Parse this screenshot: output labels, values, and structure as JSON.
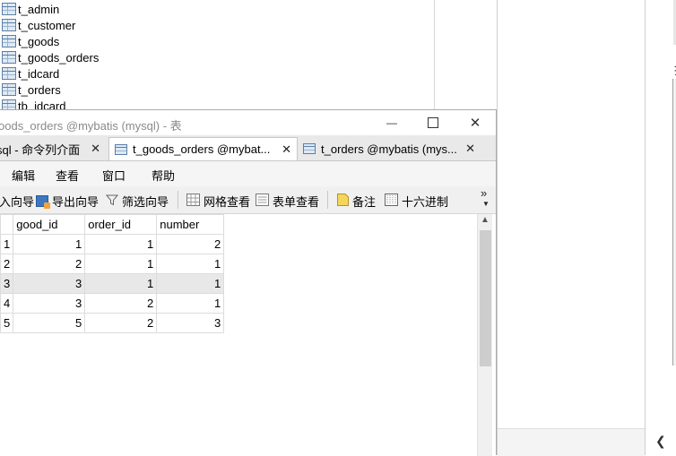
{
  "tree": {
    "items": [
      "t_admin",
      "t_customer",
      "t_goods",
      "t_goods_orders",
      "t_idcard",
      "t_orders",
      "tb_idcard"
    ]
  },
  "window": {
    "title": "oods_orders @mybatis (mysql) - 表",
    "minimize_glyph": "—",
    "maximize_glyph": "☐",
    "close_glyph": "✕"
  },
  "tabs": [
    {
      "label": "sql - 命令列介面",
      "close": "✕",
      "active": false
    },
    {
      "label": "t_goods_orders @mybat...",
      "close": "✕",
      "active": true
    },
    {
      "label": "t_orders @mybatis (mys...",
      "close": "✕",
      "active": false
    }
  ],
  "menu": [
    "编辑",
    "查看",
    "窗口",
    "帮助"
  ],
  "toolbar": {
    "import": "入向导",
    "export": "导出向导",
    "filter": "筛选向导",
    "grid_view": "网格查看",
    "form_view": "表单查看",
    "memo": "备注",
    "hex": "十六进制",
    "more": "»"
  },
  "grid": {
    "columns": [
      "good_id",
      "order_id",
      "number"
    ],
    "rows": [
      {
        "idx": "1",
        "good_id": "1",
        "order_id": "1",
        "number": "2"
      },
      {
        "idx": "2",
        "good_id": "2",
        "order_id": "1",
        "number": "1"
      },
      {
        "idx": "3",
        "good_id": "3",
        "order_id": "1",
        "number": "1"
      },
      {
        "idx": "4",
        "good_id": "3",
        "order_id": "2",
        "number": "1"
      },
      {
        "idx": "5",
        "good_id": "5",
        "order_id": "2",
        "number": "3"
      }
    ],
    "selected_row": "3"
  },
  "right_pane": {
    "mark": "找",
    "scroll_left": "❮"
  },
  "colors": {
    "selected_row": "#e8e8e8",
    "icon_blue": "#5a7fa8"
  }
}
